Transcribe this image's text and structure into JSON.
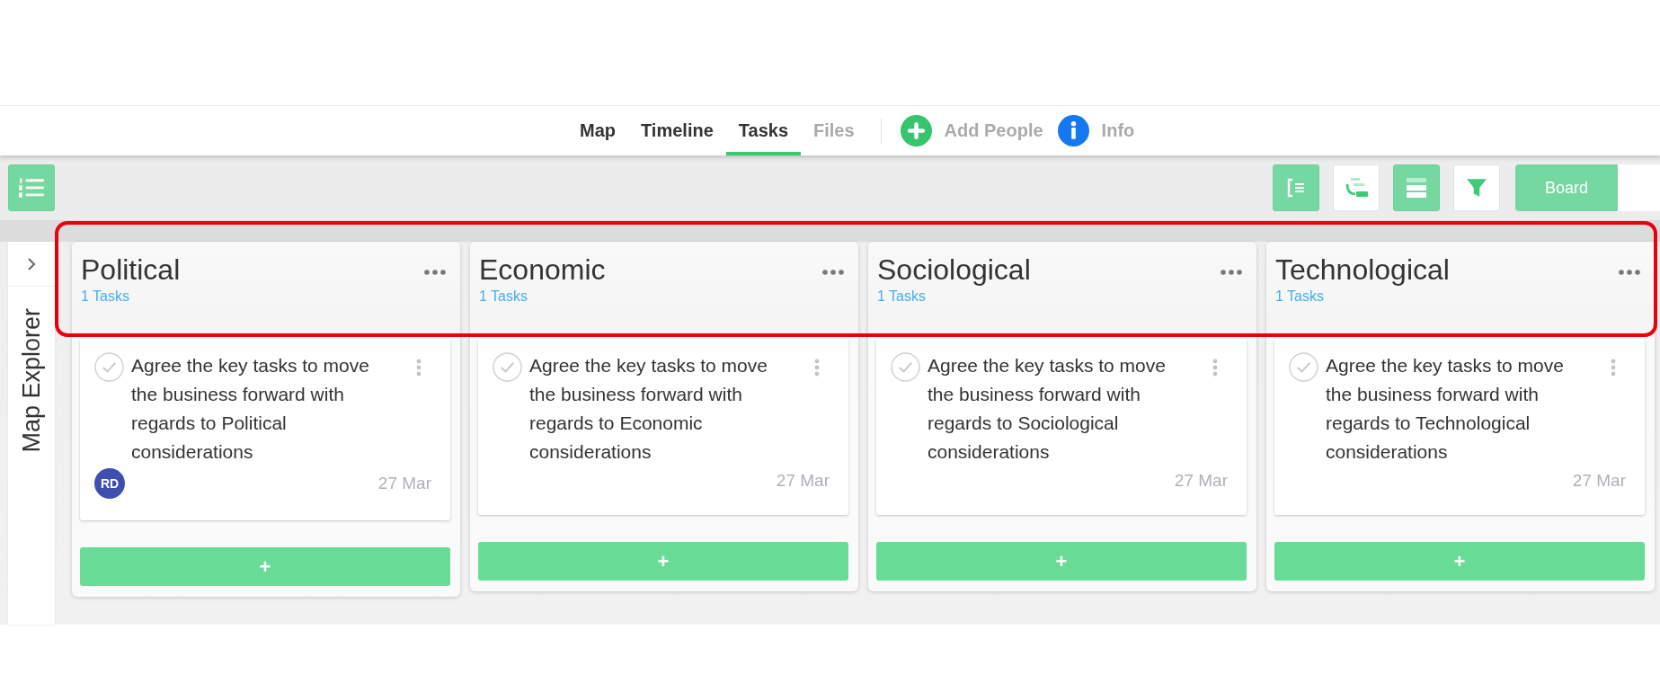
{
  "nav": {
    "tabs": [
      {
        "label": "Map",
        "selected": false,
        "disabled": false
      },
      {
        "label": "Timeline",
        "selected": false,
        "disabled": false
      },
      {
        "label": "Tasks",
        "selected": true,
        "disabled": false
      },
      {
        "label": "Files",
        "selected": false,
        "disabled": true
      }
    ],
    "actions": [
      {
        "kind": "add",
        "label": "Add People"
      },
      {
        "kind": "info",
        "label": "Info"
      }
    ]
  },
  "toolbar": {
    "left": [
      {
        "kind": "numbered-list",
        "on": true
      }
    ],
    "right": [
      {
        "kind": "outline",
        "on": true
      },
      {
        "kind": "gantt",
        "on": false
      },
      {
        "kind": "rows",
        "on": true
      },
      {
        "kind": "filter",
        "on": false
      }
    ],
    "view_switch": [
      {
        "label": "Board",
        "selected": true
      },
      {
        "selected": false
      }
    ]
  },
  "sidebar": {
    "title": "Map Explorer",
    "expanded": false
  },
  "columns": [
    {
      "title": "Political",
      "count": "1 Tasks",
      "tasks": [
        {
          "text": "Agree the key tasks to move the business forward with regards to Political considerations",
          "done": false,
          "assignee": "RD",
          "date": "27 Mar"
        }
      ],
      "add_label": "+"
    },
    {
      "title": "Economic",
      "count": "1 Tasks",
      "tasks": [
        {
          "text": "Agree the key tasks to move the business forward with regards to Economic considerations",
          "done": false,
          "date": "27 Mar"
        }
      ],
      "add_label": "+"
    },
    {
      "title": "Sociological",
      "count": "1 Tasks",
      "tasks": [
        {
          "text": "Agree the key tasks to move the business forward with regards to Sociological considerations",
          "done": false,
          "date": "27 Mar"
        }
      ],
      "add_label": "+"
    },
    {
      "title": "Technological",
      "count": "1 Tasks",
      "tasks": [
        {
          "text": "Agree the key tasks to move the business forward with regards to Technological considerations",
          "done": false,
          "date": "27 Mar"
        }
      ],
      "add_label": "+"
    }
  ]
}
